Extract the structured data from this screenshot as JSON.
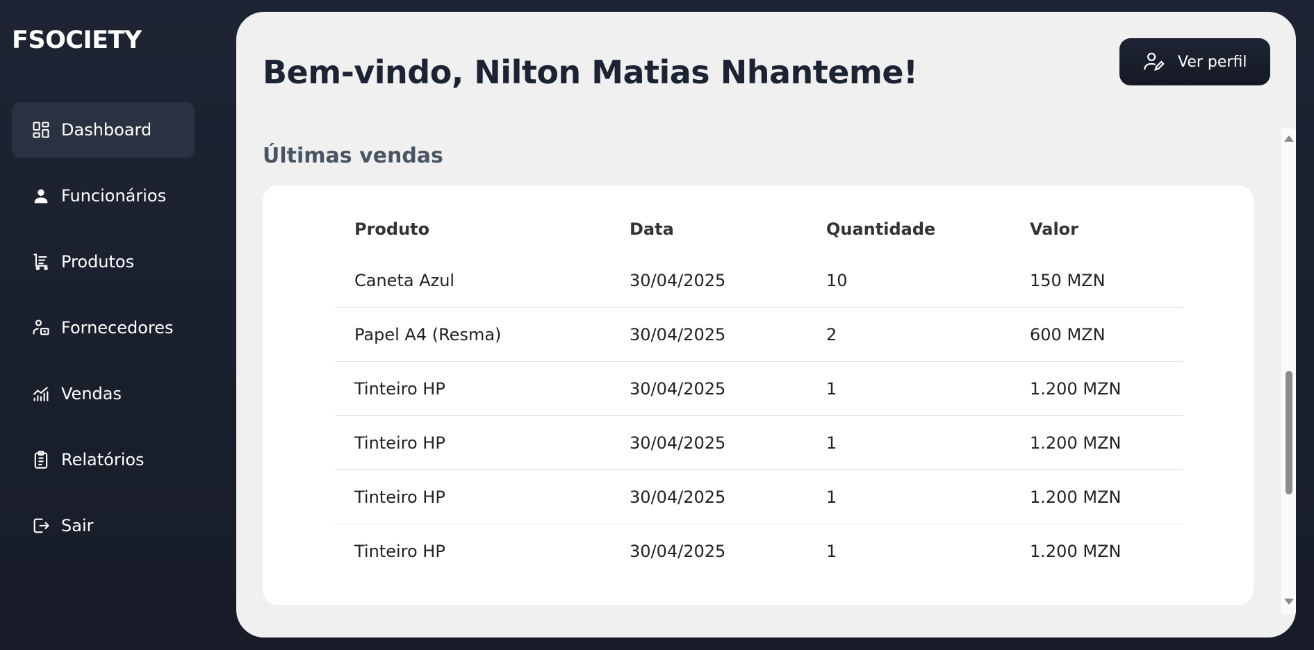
{
  "sidebar": {
    "brand": "FSOCIETY",
    "items": [
      {
        "label": "Dashboard",
        "icon": "dashboard-icon"
      },
      {
        "label": "Funcionários",
        "icon": "user-icon"
      },
      {
        "label": "Produtos",
        "icon": "cart-icon"
      },
      {
        "label": "Fornecedores",
        "icon": "supplier-icon"
      },
      {
        "label": "Vendas",
        "icon": "chart-icon"
      },
      {
        "label": "Relatórios",
        "icon": "clipboard-icon"
      },
      {
        "label": "Sair",
        "icon": "logout-icon"
      }
    ]
  },
  "header": {
    "title": "Bem-vindo, Nilton Matias Nhanteme!",
    "profile_button": "Ver perfil"
  },
  "sales": {
    "section_title": "Últimas vendas",
    "columns": [
      "Produto",
      "Data",
      "Quantidade",
      "Valor"
    ],
    "rows": [
      [
        "Caneta Azul",
        "30/04/2025",
        "10",
        "150 MZN"
      ],
      [
        "Papel A4 (Resma)",
        "30/04/2025",
        "2",
        "600 MZN"
      ],
      [
        "Tinteiro HP",
        "30/04/2025",
        "1",
        "1.200 MZN"
      ],
      [
        "Tinteiro HP",
        "30/04/2025",
        "1",
        "1.200 MZN"
      ],
      [
        "Tinteiro HP",
        "30/04/2025",
        "1",
        "1.200 MZN"
      ],
      [
        "Tinteiro HP",
        "30/04/2025",
        "1",
        "1.200 MZN"
      ]
    ]
  },
  "colors": {
    "sidebar_bg": "#1e2433",
    "main_bg": "#f0f0f0",
    "card_bg": "#ffffff",
    "title": "#1c2333",
    "section_title": "#4a5563",
    "active_item_bg": "#2a3140"
  }
}
